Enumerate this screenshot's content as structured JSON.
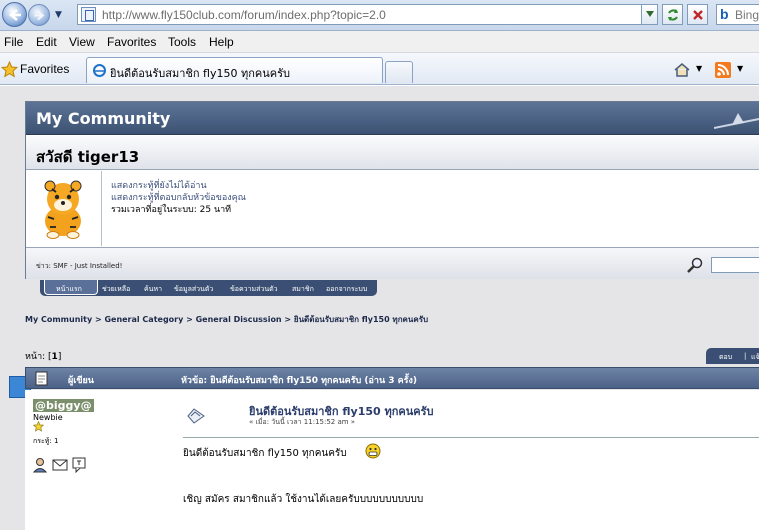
{
  "browser": {
    "url": "http://www.fly150club.com/forum/index.php?topic=2.0",
    "search_engine": "Bing",
    "menu": [
      "File",
      "Edit",
      "View",
      "Favorites",
      "Tools",
      "Help"
    ],
    "favorites_label": "Favorites",
    "tab_title": "ยินดีต้อนรับสมาชิก fly150 ทุกคนครับ"
  },
  "forum": {
    "title": "My Community",
    "greeting": "สวัสดี tiger13",
    "links": [
      "แสดงกระทู้ที่ยังไม่ได้อ่าน",
      "แสดงกระทู้ที่ตอบกลับหัวข้อของคุณ"
    ],
    "online_time": "รวมเวลาที่อยู่ในระบบ:  25 นาที",
    "news": "ข่าว: SMF - Just Installed!",
    "main_menu": [
      "หน้าแรก",
      "ช่วยเหลือ",
      "ค้นหา",
      "ข้อมูลส่วนตัว",
      "ข้อความส่วนตัว",
      "สมาชิก",
      "ออกจากระบบ"
    ],
    "breadcrumb": "My Community > General Category > General Discussion > ยินดีต้อนรับสมาชิก fly150 ทุกคนครับ",
    "pages_label": "หน้า:",
    "pages_current": "1",
    "topic_buttons": [
      "ตอบ",
      "แจ้ง"
    ]
  },
  "topic": {
    "author_header": "ผู้เขียน",
    "topic_header": "หัวข้อ: ยินดีต้อนรับสมาชิก fly150 ทุกคนครับ  (อ่าน 3 ครั้ง)"
  },
  "post": {
    "author": "@biggy@",
    "rank": "Newbie",
    "post_count": "กระทู้: 1",
    "subject": "ยินดีต้อนรับสมาชิก fly150 ทุกคนครับ",
    "date": "« เมื่อ: วันนี้ เวลา 11:15:52 am »",
    "body_line1": "ยินดีต้อนรับสมาชิก fly150 ทุกคนครับ",
    "body_line2": "เชิญ สมัคร สมาชิกแล้ว ใช้งานได้เลยครับบบบบบบบบบบ"
  },
  "colors": {
    "header_blue": "#4c6186",
    "link": "#3a4e7a",
    "page_bg": "#e5e5e8"
  }
}
